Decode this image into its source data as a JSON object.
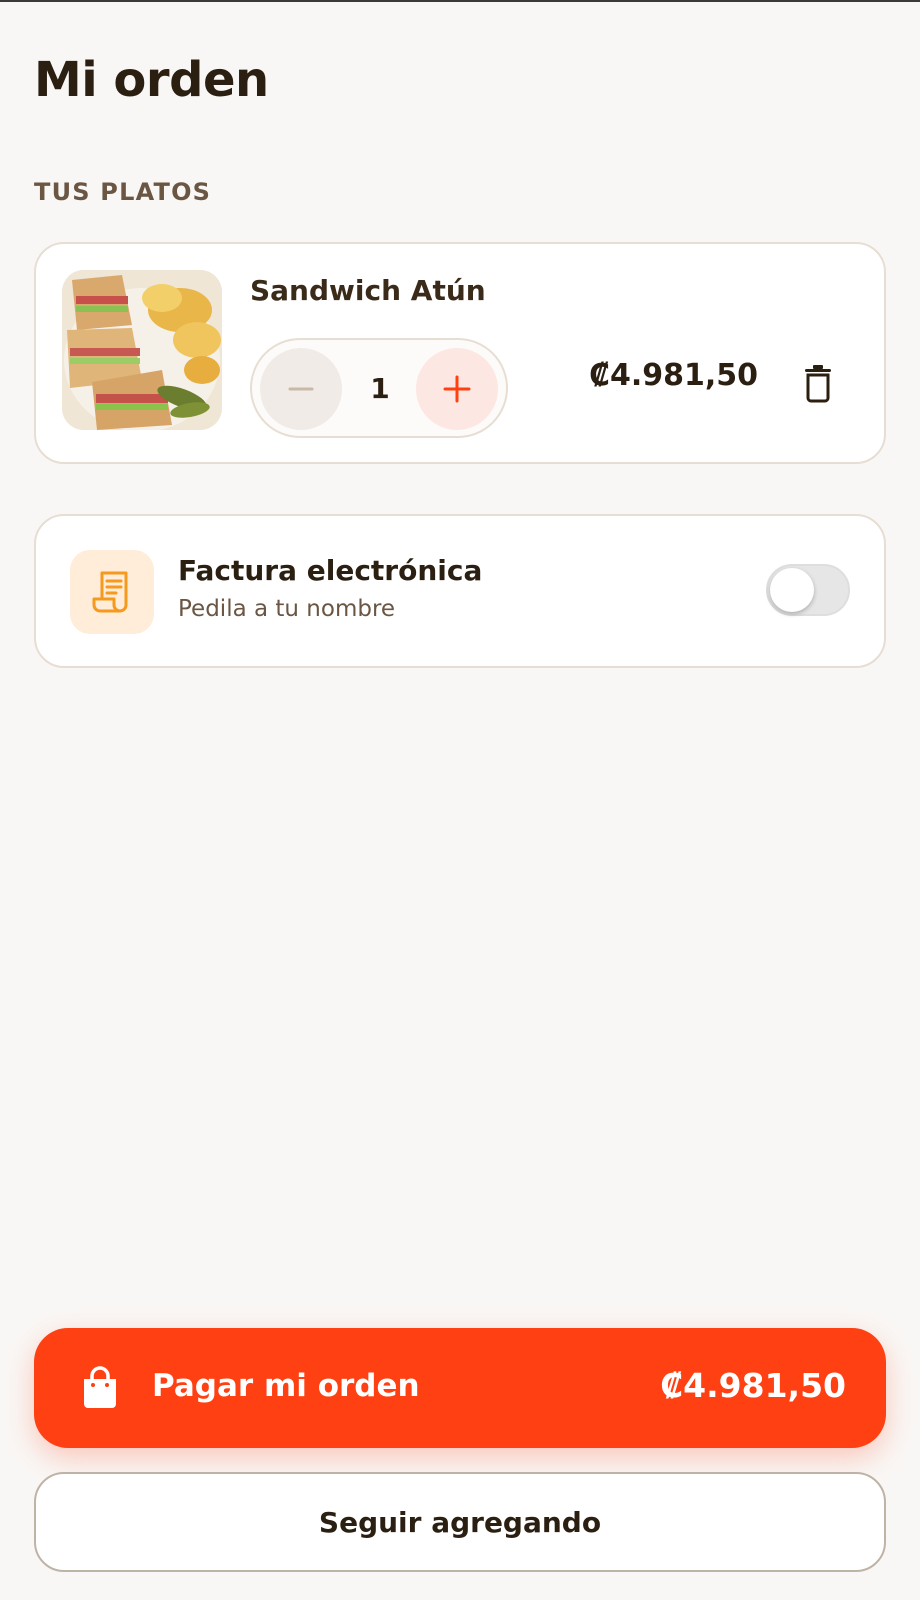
{
  "header": {
    "title": "Mi orden"
  },
  "cart": {
    "section_label": "TUS PLATOS",
    "items": [
      {
        "name": "Sandwich Atún",
        "quantity": "1",
        "price": "₡4.981,50",
        "image_icon": "sandwich-photo"
      }
    ]
  },
  "invoice": {
    "title": "Factura electrónica",
    "subtitle": "Pedila a tu nombre",
    "icon": "receipt-icon",
    "toggle_on": false
  },
  "actions": {
    "pay_label": "Pagar mi orden",
    "pay_total": "₡4.981,50",
    "pay_icon": "shopping-bag-icon",
    "continue_label": "Seguir agregando"
  },
  "colors": {
    "accent": "#ff4012",
    "text": "#2b1f12",
    "muted": "#6b5643",
    "invoice_icon_bg": "#ffecd9",
    "invoice_icon": "#f59a1d"
  }
}
